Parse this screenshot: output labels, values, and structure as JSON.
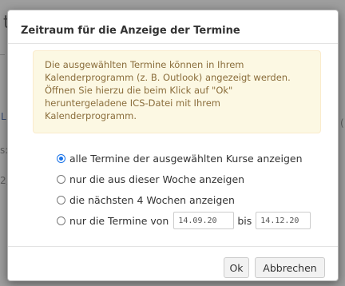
{
  "background": {
    "glyphs": [
      "t",
      "L",
      "s:",
      "2,",
      "("
    ]
  },
  "dialog": {
    "title": "Zeitraum für die Anzeige der Termine",
    "notice_lines": [
      "Die ausgewählten Termine können in Ihrem",
      "Kalenderprogramm (z. B. Outlook) angezeigt werden.",
      "Öffnen Sie hierzu die beim Klick auf \"Ok\"",
      "heruntergeladene ICS-Datei mit Ihrem",
      "Kalenderprogramm."
    ],
    "options": {
      "all_label": "alle Termine der ausgewählten Kurse anzeigen",
      "week_label": "nur die aus dieser Woche anzeigen",
      "next4_label": "die nächsten 4 Wochen anzeigen",
      "range_label": "nur die Termine von",
      "range_sep": "bis",
      "selected": "all"
    },
    "date_from": "14.09.20",
    "date_to": "14.12.20",
    "buttons": {
      "ok": "Ok",
      "cancel": "Abbrechen"
    }
  },
  "colors": {
    "notice_bg": "#fcf8e3",
    "notice_text": "#8a6d3b",
    "radio_accent": "#1a73e8"
  }
}
